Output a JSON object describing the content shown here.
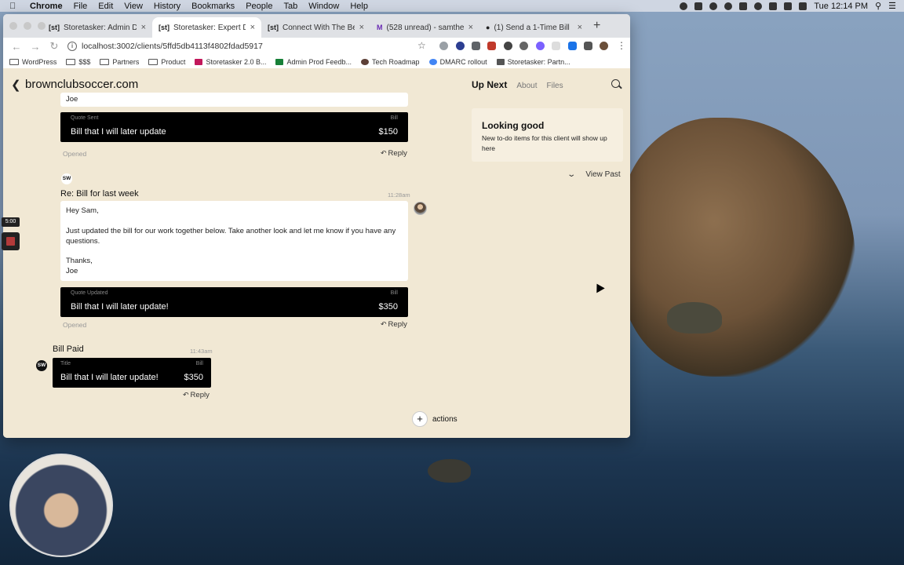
{
  "menubar": {
    "app": "Chrome",
    "items": [
      "File",
      "Edit",
      "View",
      "History",
      "Bookmarks",
      "People",
      "Tab",
      "Window",
      "Help"
    ],
    "clock": "Tue 12:14 PM"
  },
  "browser": {
    "tabs": [
      {
        "favicon": "[st]",
        "label": "Storetasker: Admin Dashbo"
      },
      {
        "favicon": "[st]",
        "label": "Storetasker: Expert Dashb"
      },
      {
        "favicon": "[st]",
        "label": "Connect With The Best Sh"
      },
      {
        "favicon": "M",
        "label": "(528 unread) - samthesan"
      },
      {
        "favicon": "●",
        "label": "(1) Send a 1-Time Bill"
      }
    ],
    "url": "localhost:3002/clients/5ffd5db4113f4802fdad5917",
    "bookmarks": [
      "WordPress",
      "$$$",
      "Partners",
      "Product",
      "Storetasker 2.0 B...",
      "Admin Prod Feedb...",
      "Tech Roadmap",
      "DMARC rollout",
      "Storetasker: Partn..."
    ]
  },
  "page": {
    "client": "brownclubsoccer.com",
    "tabs": {
      "up_next": "Up Next",
      "about": "About",
      "files": "Files"
    },
    "messages": {
      "first": {
        "tail": "Joe",
        "bar_label": "Quote Sent",
        "bar_type": "Bill",
        "bar_title": "Bill that I will later update",
        "bar_amount": "$150",
        "status": "Opened",
        "reply": "Reply"
      },
      "second": {
        "initials": "SW",
        "subject": "Re: Bill for last week",
        "time": "11:28am",
        "greeting": "Hey Sam,",
        "body": "Just updated the bill for our work together below. Take another look and let me know if you have any questions.",
        "thanks": "Thanks,",
        "signature": "Joe",
        "bar_label": "Quote Updated",
        "bar_type": "Bill",
        "bar_title": "Bill that I will later update!",
        "bar_amount": "$350",
        "status": "Opened",
        "reply": "Reply"
      },
      "third": {
        "initials": "SW",
        "subject": "Bill Paid",
        "time": "11:43am",
        "bar_label": "Title",
        "bar_type": "Bill",
        "bar_title": "Bill that I will later update!",
        "bar_amount": "$350",
        "reply": "Reply"
      }
    },
    "sidebar": {
      "title": "Looking good",
      "description": "New to-do items for this client will show up here",
      "view_past": "View Past"
    },
    "actions_label": "actions"
  },
  "recording": {
    "timer": "5:00"
  }
}
